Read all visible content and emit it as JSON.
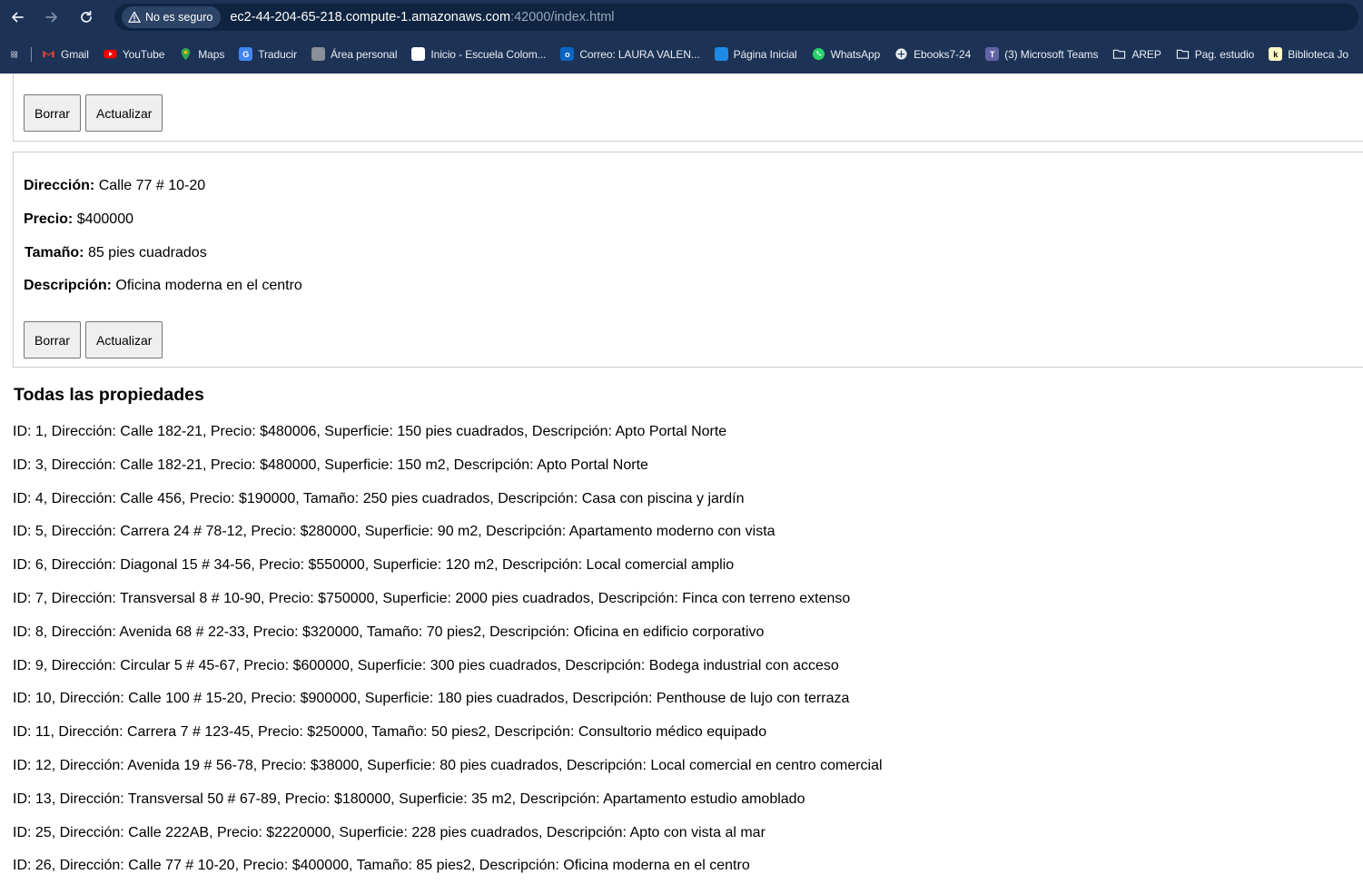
{
  "browser": {
    "security_label": "No es seguro",
    "url_host": "ec2-44-204-65-218.compute-1.amazonaws.com",
    "url_rest": ":42000/index.html",
    "bookmarks": [
      {
        "label": "Gmail",
        "icon": "gmail-icon"
      },
      {
        "label": "YouTube",
        "icon": "youtube-icon"
      },
      {
        "label": "Maps",
        "icon": "maps-icon"
      },
      {
        "label": "Traducir",
        "icon": "translate-icon"
      },
      {
        "label": "Área personal",
        "icon": "area-personal-icon"
      },
      {
        "label": "Inicio - Escuela Colom...",
        "icon": "escuela-icon"
      },
      {
        "label": "Correo: LAURA VALEN...",
        "icon": "outlook-icon"
      },
      {
        "label": "Página Inicial",
        "icon": "pagina-inicial-icon"
      },
      {
        "label": "WhatsApp",
        "icon": "whatsapp-icon"
      },
      {
        "label": "Ebooks7-24",
        "icon": "ebooks-icon"
      },
      {
        "label": "(3) Microsoft Teams",
        "icon": "teams-icon"
      },
      {
        "label": "AREP",
        "icon": "folder-icon"
      },
      {
        "label": "Pag. estudio",
        "icon": "folder-icon"
      },
      {
        "label": "Biblioteca Jo",
        "icon": "biblioteca-icon"
      }
    ]
  },
  "top_card": {
    "delete_label": "Borrar",
    "update_label": "Actualizar"
  },
  "property_card": {
    "address_label": "Dirección:",
    "address_value": "Calle 77 # 10-20",
    "price_label": "Precio:",
    "price_value": "$400000",
    "size_label": "Tamaño:",
    "size_value": "85 pies cuadrados",
    "description_label": "Descripción:",
    "description_value": "Oficina moderna en el centro",
    "delete_label": "Borrar",
    "update_label": "Actualizar"
  },
  "all_properties": {
    "title": "Todas las propiedades",
    "items": [
      "ID: 1, Dirección: Calle 182-21, Precio: $480006, Superficie: 150 pies cuadrados, Descripción: Apto Portal Norte",
      "ID: 3, Dirección: Calle 182-21, Precio: $480000, Superficie: 150 m2, Descripción: Apto Portal Norte",
      "ID: 4, Dirección: Calle 456, Precio: $190000, Tamaño: 250 pies cuadrados, Descripción: Casa con piscina y jardín",
      "ID: 5, Dirección: Carrera 24 # 78-12, Precio: $280000, Superficie: 90 m2, Descripción: Apartamento moderno con vista",
      "ID: 6, Dirección: Diagonal 15 # 34-56, Precio: $550000, Superficie: 120 m2, Descripción: Local comercial amplio",
      "ID: 7, Dirección: Transversal 8 # 10-90, Precio: $750000, Superficie: 2000 pies cuadrados, Descripción: Finca con terreno extenso",
      "ID: 8, Dirección: Avenida 68 # 22-33, Precio: $320000, Tamaño: 70 pies2, Descripción: Oficina en edificio corporativo",
      "ID: 9, Dirección: Circular 5 # 45-67, Precio: $600000, Superficie: 300 pies cuadrados, Descripción: Bodega industrial con acceso",
      "ID: 10, Dirección: Calle 100 # 15-20, Precio: $900000, Superficie: 180 pies cuadrados, Descripción: Penthouse de lujo con terraza",
      "ID: 11, Dirección: Carrera 7 # 123-45, Precio: $250000, Tamaño: 50 pies2, Descripción: Consultorio médico equipado",
      "ID: 12, Dirección: Avenida 19 # 56-78, Precio: $38000, Superficie: 80 pies cuadrados, Descripción: Local comercial en centro comercial",
      "ID: 13, Dirección: Transversal 50 # 67-89, Precio: $180000, Superficie: 35 m2, Descripción: Apartamento estudio amoblado",
      "ID: 25, Dirección: Calle 222AB, Precio: $2220000, Superficie: 228 pies cuadrados, Descripción: Apto con vista al mar",
      "ID: 26, Dirección: Calle 77 # 10-20, Precio: $400000, Tamaño: 85 pies2, Descripción: Oficina moderna en el centro"
    ]
  }
}
